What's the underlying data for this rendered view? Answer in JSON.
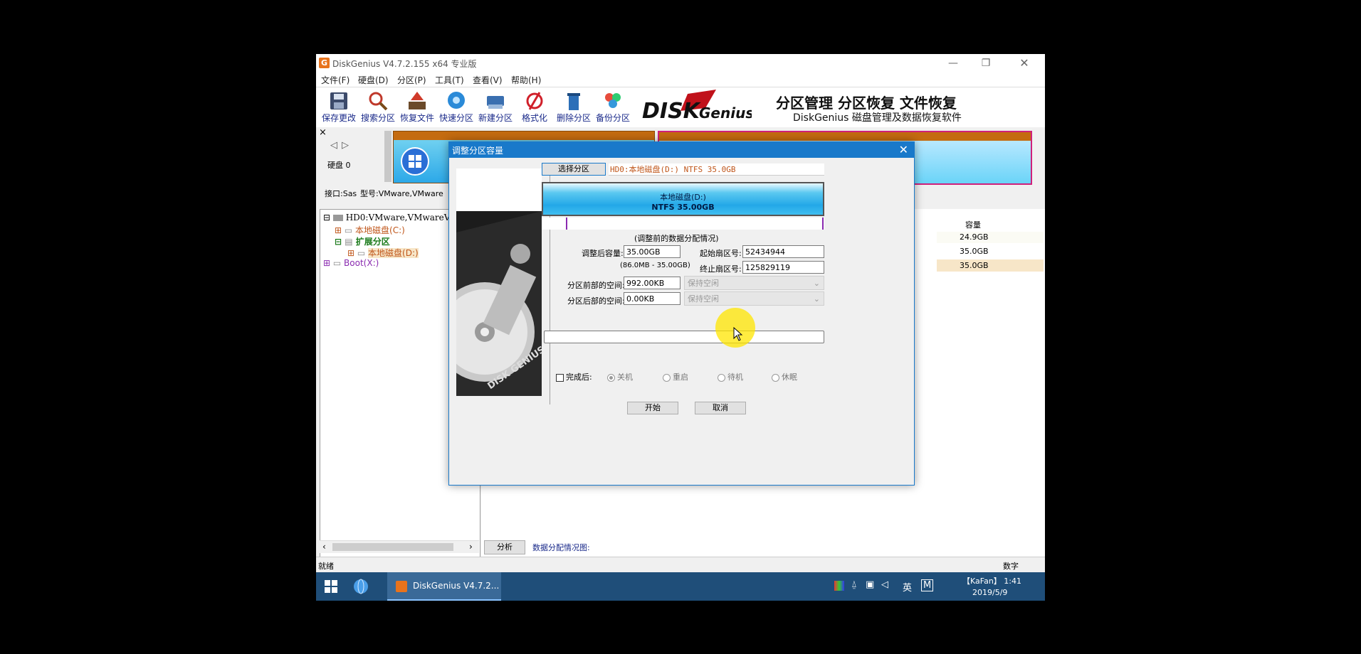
{
  "window": {
    "title": "DiskGenius V4.7.2.155 x64 专业版",
    "app_icon_glyph": "G",
    "controls": {
      "minimize": "—",
      "restore": "❐",
      "close": "✕"
    }
  },
  "menu": [
    "文件(F)",
    "硬盘(D)",
    "分区(P)",
    "工具(T)",
    "查看(V)",
    "帮助(H)"
  ],
  "toolbar": [
    {
      "label": "保存更改",
      "icon": "save-icon"
    },
    {
      "label": "搜索分区",
      "icon": "search-icon"
    },
    {
      "label": "恢复文件",
      "icon": "recover-files-icon"
    },
    {
      "label": "快速分区",
      "icon": "quick-partition-icon"
    },
    {
      "label": "新建分区",
      "icon": "new-partition-icon"
    },
    {
      "label": "格式化",
      "icon": "format-icon"
    },
    {
      "label": "删除分区",
      "icon": "delete-partition-icon"
    },
    {
      "label": "备份分区",
      "icon": "backup-partition-icon"
    }
  ],
  "banner": {
    "logo_text": "DISKGenius",
    "headline": "分区管理 分区恢复 文件恢复",
    "tagline": "DiskGenius 磁盘管理及数据恢复软件"
  },
  "disk_nav": {
    "close": "×",
    "prev": "◁",
    "next": "▷",
    "disk_label": "硬盘 0"
  },
  "info_line": {
    "interface": "接口:Sas",
    "model": "型号:VMware,VMware"
  },
  "tree": {
    "disk": "HD0:VMware,VMwareVir",
    "c": "本地磁盘(C:)",
    "ext": "扩展分区",
    "d": "本地磁盘(D:)",
    "boot": "Boot(X:)"
  },
  "right_panel": {
    "capacity_header": "容量",
    "capacities": [
      "24.9GB",
      "35.0GB",
      "35.0GB"
    ],
    "analyze_button": "分析",
    "analysis_label": "数据分配情况图:"
  },
  "status": {
    "left": "就绪",
    "right": "数字"
  },
  "taskbar": {
    "app": "DiskGenius V4.7.2...",
    "tray_lang": "英",
    "tray_ime": "M",
    "clock_user": "【KaFan】 1:41",
    "clock_date": "2019/5/9"
  },
  "dialog": {
    "title": "调整分区容量",
    "close": "✕",
    "select_partition_button": "选择分区",
    "selected_partition": "HD0:本地磁盘(D:) NTFS 35.0GB",
    "partition_name": "本地磁盘(D:)",
    "partition_fs_size": "NTFS 35.00GB",
    "section_caption": "(调整前的数据分配情况)",
    "size_label": "调整后容量:",
    "size_value": "35.00GB",
    "size_range": "(86.0MB - 35.00GB)",
    "start_sector_label": "起始扇区号:",
    "start_sector_value": "52434944",
    "end_sector_label": "终止扇区号:",
    "end_sector_value": "125829119",
    "before_label": "分区前部的空间:",
    "before_value": "992.00KB",
    "before_option": "保持空闲",
    "after_label": "分区后部的空间:",
    "after_value": "0.00KB",
    "after_option": "保持空闲",
    "on_finish_label": "完成后:",
    "radios": [
      "关机",
      "重启",
      "待机",
      "休眠"
    ],
    "start_button": "开始",
    "cancel_button": "取消",
    "side_image_text": "DISK GENIUS"
  }
}
